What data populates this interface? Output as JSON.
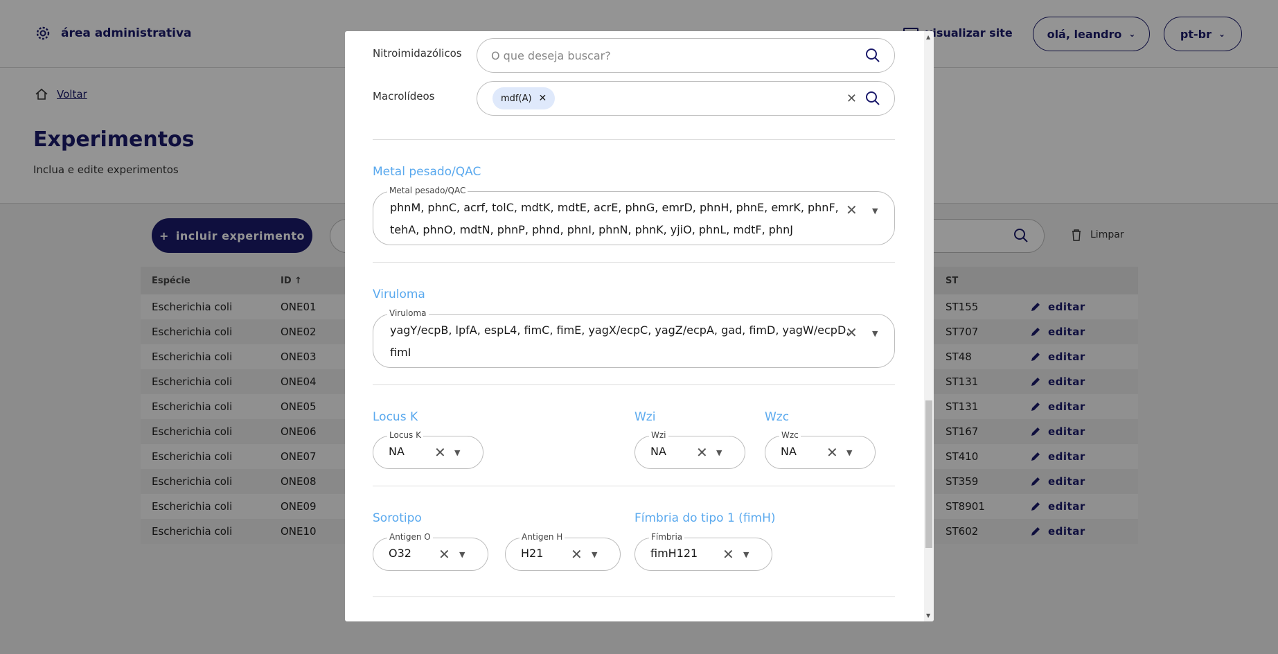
{
  "header": {
    "brand": "área administrativa",
    "view_site": "visualizar site",
    "user": "olá, leandro",
    "lang": "pt-br"
  },
  "page": {
    "back": "Voltar",
    "title": "Experimentos",
    "subtitle": "Inclua e edite experimentos",
    "add_button": "incluir experimento",
    "clear": "Limpar"
  },
  "table": {
    "headers": [
      "Espécie",
      "ID",
      "ST"
    ],
    "rows": [
      {
        "species": "Escherichia coli",
        "id": "ONE01",
        "st": "ST155"
      },
      {
        "species": "Escherichia coli",
        "id": "ONE02",
        "st": "ST707"
      },
      {
        "species": "Escherichia coli",
        "id": "ONE03",
        "st": "ST48"
      },
      {
        "species": "Escherichia coli",
        "id": "ONE04",
        "st": "ST131"
      },
      {
        "species": "Escherichia coli",
        "id": "ONE05",
        "st": "ST131"
      },
      {
        "species": "Escherichia coli",
        "id": "ONE06",
        "st": "ST167"
      },
      {
        "species": "Escherichia coli",
        "id": "ONE07",
        "st": "ST410"
      },
      {
        "species": "Escherichia coli",
        "id": "ONE08",
        "st": "ST359"
      },
      {
        "species": "Escherichia coli",
        "id": "ONE09",
        "st": "ST8901"
      },
      {
        "species": "Escherichia coli",
        "id": "ONE10",
        "st": "ST602"
      }
    ],
    "edit_label": "editar"
  },
  "modal": {
    "nitro": {
      "label": "Nitroimidazólicos",
      "placeholder": "O que deseja buscar?"
    },
    "macro": {
      "label": "Macrolídeos",
      "chip": "mdf(A)"
    },
    "metal": {
      "section": "Metal pesado/QAC",
      "legend": "Metal pesado/QAC",
      "line1": "phnM, phnC, acrf, tolC, mdtK, mdtE, acrE, phnG, emrD, phnH, phnE, emrK, phnF,",
      "line2": "tehA, phnO, mdtN, phnP, phnd, phnI, phnN, phnK, yjiO, phnL, mdtF, phnJ"
    },
    "viruloma": {
      "section": "Viruloma",
      "legend": "Viruloma",
      "line1": "yagY/ecpB, lpfA, espL4, fimC, fimE, yagX/ecpC, yagZ/ecpA, gad, fimD, yagW/ecpD,",
      "line2": "fimI"
    },
    "locus_k": {
      "section": "Locus K",
      "legend": "Locus K",
      "value": "NA"
    },
    "wzi": {
      "section": "Wzi",
      "legend": "Wzi",
      "value": "NA"
    },
    "wzc": {
      "section": "Wzc",
      "legend": "Wzc",
      "value": "NA"
    },
    "sorotipo": {
      "section": "Sorotipo",
      "antigen_o": {
        "legend": "Antigen O",
        "value": "O32"
      },
      "antigen_h": {
        "legend": "Antigen H",
        "value": "H21"
      }
    },
    "fimbria": {
      "section": "Fímbria do tipo 1 (fimH)",
      "legend": "Fímbria",
      "value": "fimH121"
    }
  }
}
